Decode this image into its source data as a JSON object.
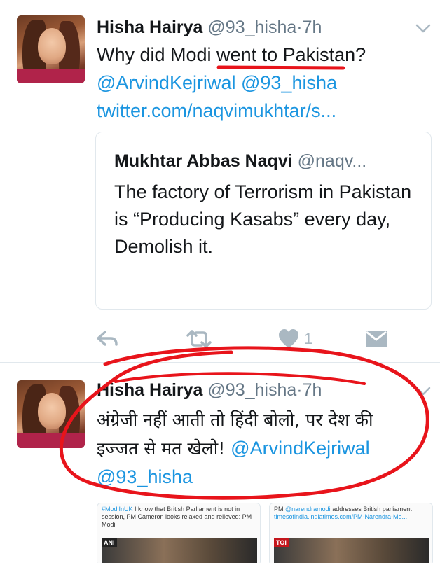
{
  "tweets": [
    {
      "display_name": "Hisha Hairya",
      "handle": "@93_hisha",
      "separator": "·",
      "time": "7h",
      "text_line1": "Why did Modi went to Pakistan?",
      "mention1": "@ArvindKejriwal",
      "mention2": "@93_hisha",
      "url": "twitter.com/naqvimukhtar/s...",
      "quote": {
        "name": "Mukhtar Abbas Naqvi",
        "handle": "@naqv...",
        "text": "The factory of Terrorism in Pakistan is “Producing Kasabs” every day, Demolish it."
      },
      "actions": {
        "reply_icon": "reply-icon",
        "retweet_icon": "retweet-icon",
        "like_icon": "heart-icon",
        "like_count": "1",
        "dm_icon": "envelope-icon"
      }
    },
    {
      "display_name": "Hisha Hairya",
      "handle": "@93_hisha",
      "separator": "·",
      "time": "7h",
      "text_line1": "अंग्रेजी नहीं आती तो हिंदी बोलो, पर देश की",
      "text_line2_prefix": "इज्जत से मत खेलो!",
      "mention1": "@ArvindKejriwal",
      "mention2": "@93_hisha",
      "media": [
        {
          "caption_tag": "#ModiInUK",
          "caption": "I know that British Parliament is not in session, PM Cameron looks relaxed and relieved: PM Modi",
          "logo": "ANI"
        },
        {
          "caption_prefix": "PM",
          "caption_mention": "@narendramodi",
          "caption": "addresses British parliament",
          "caption_link": "timesofindia.indiatimes.com/PM-Narendra-Mo...",
          "logo": "TOI"
        }
      ]
    }
  ],
  "colors": {
    "link": "#1b95e0",
    "text": "#14171a",
    "muted": "#657786",
    "icon": "#aab8c2",
    "annotation": "#e8141b"
  }
}
